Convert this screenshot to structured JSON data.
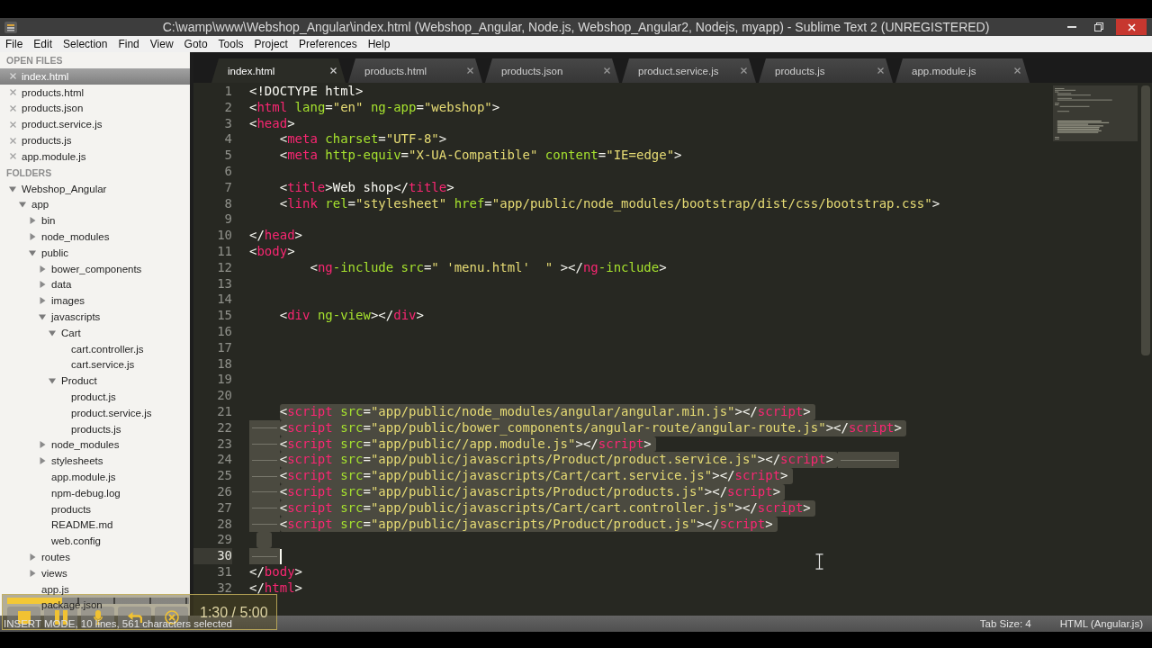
{
  "window": {
    "title": "C:\\wamp\\www\\Webshop_Angular\\index.html (Webshop_Angular, Node.js, Webshop_Angular2, Nodejs, myapp) - Sublime Text 2 (UNREGISTERED)"
  },
  "menu": [
    "File",
    "Edit",
    "Selection",
    "Find",
    "View",
    "Goto",
    "Tools",
    "Project",
    "Preferences",
    "Help"
  ],
  "sidebar": {
    "open_files_heading": "OPEN FILES",
    "open_files": [
      {
        "name": "index.html",
        "selected": true
      },
      {
        "name": "products.html",
        "selected": false
      },
      {
        "name": "products.json",
        "selected": false
      },
      {
        "name": "product.service.js",
        "selected": false
      },
      {
        "name": "products.js",
        "selected": false
      },
      {
        "name": "app.module.js",
        "selected": false
      }
    ],
    "folders_heading": "FOLDERS",
    "folders": [
      {
        "name": "Webshop_Angular",
        "kind": "folder",
        "expanded": true,
        "children": [
          {
            "name": "app",
            "kind": "folder",
            "expanded": true,
            "children": [
              {
                "name": "bin",
                "kind": "folder",
                "expanded": false
              },
              {
                "name": "node_modules",
                "kind": "folder",
                "expanded": false
              },
              {
                "name": "public",
                "kind": "folder",
                "expanded": true,
                "children": [
                  {
                    "name": "bower_components",
                    "kind": "folder",
                    "expanded": false
                  },
                  {
                    "name": "data",
                    "kind": "folder",
                    "expanded": false
                  },
                  {
                    "name": "images",
                    "kind": "folder",
                    "expanded": false
                  },
                  {
                    "name": "javascripts",
                    "kind": "folder",
                    "expanded": true,
                    "children": [
                      {
                        "name": "Cart",
                        "kind": "folder",
                        "expanded": true,
                        "children": [
                          {
                            "name": "cart.controller.js",
                            "kind": "file"
                          },
                          {
                            "name": "cart.service.js",
                            "kind": "file"
                          }
                        ]
                      },
                      {
                        "name": "Product",
                        "kind": "folder",
                        "expanded": true,
                        "children": [
                          {
                            "name": "product.js",
                            "kind": "file"
                          },
                          {
                            "name": "product.service.js",
                            "kind": "file"
                          },
                          {
                            "name": "products.js",
                            "kind": "file"
                          }
                        ]
                      }
                    ]
                  },
                  {
                    "name": "node_modules",
                    "kind": "folder",
                    "expanded": false
                  },
                  {
                    "name": "stylesheets",
                    "kind": "folder",
                    "expanded": false
                  },
                  {
                    "name": "app.module.js",
                    "kind": "file"
                  },
                  {
                    "name": "npm-debug.log",
                    "kind": "file"
                  },
                  {
                    "name": "products",
                    "kind": "file"
                  },
                  {
                    "name": "README.md",
                    "kind": "file"
                  },
                  {
                    "name": "web.config",
                    "kind": "file"
                  }
                ]
              },
              {
                "name": "routes",
                "kind": "folder",
                "expanded": false
              },
              {
                "name": "views",
                "kind": "folder",
                "expanded": false
              },
              {
                "name": "app.js",
                "kind": "file"
              },
              {
                "name": "package.json",
                "kind": "file"
              }
            ]
          }
        ]
      }
    ]
  },
  "tabs": [
    {
      "label": "index.html",
      "selected": true
    },
    {
      "label": "products.html",
      "selected": false
    },
    {
      "label": "products.json",
      "selected": false
    },
    {
      "label": "product.service.js",
      "selected": false
    },
    {
      "label": "products.js",
      "selected": false
    },
    {
      "label": "app.module.js",
      "selected": false
    }
  ],
  "editor": {
    "lines": [
      {
        "number": "1",
        "code": "<!DOCTYPE html>",
        "kind": "plain",
        "selected": false,
        "cursor": false
      },
      {
        "number": "2",
        "code": "<html lang=\"en\" ng-app=\"webshop\">",
        "kind": "plain",
        "selected": false,
        "cursor": false
      },
      {
        "number": "3",
        "code": "<head>",
        "kind": "plain",
        "selected": false,
        "cursor": false
      },
      {
        "number": "4",
        "code": "    <meta charset=\"UTF-8\">",
        "kind": "plain",
        "selected": false,
        "cursor": false
      },
      {
        "number": "5",
        "code": "    <meta http-equiv=\"X-UA-Compatible\" content=\"IE=edge\">",
        "kind": "plain",
        "selected": false,
        "cursor": false
      },
      {
        "number": "6",
        "kind": "plain",
        "selected": false,
        "cursor": false
      },
      {
        "number": "7",
        "code": "    <title>Web shop</title>",
        "kind": "plain",
        "selected": false,
        "cursor": false
      },
      {
        "number": "8",
        "code": "    <link rel=\"stylesheet\" href=\"app/public/node_modules/bootstrap/dist/css/bootstrap.css\">",
        "kind": "plain",
        "selected": false,
        "cursor": false
      },
      {
        "number": "9",
        "kind": "plain",
        "selected": false,
        "cursor": false
      },
      {
        "number": "10",
        "code": "</head>",
        "kind": "plain",
        "selected": false,
        "cursor": false
      },
      {
        "number": "11",
        "code": "<body>",
        "kind": "plain",
        "selected": false,
        "cursor": false
      },
      {
        "number": "12",
        "code": "        <ng-include src=\" 'menu.html'  \" ></ng-include>",
        "kind": "plain",
        "selected": false,
        "cursor": false
      },
      {
        "number": "13",
        "kind": "plain",
        "selected": false,
        "cursor": false
      },
      {
        "number": "14",
        "kind": "plain",
        "selected": false,
        "cursor": false
      },
      {
        "number": "15",
        "code": "    <div ng-view></div>",
        "kind": "plain",
        "selected": false,
        "cursor": false
      },
      {
        "number": "16",
        "kind": "plain",
        "selected": false,
        "cursor": false
      },
      {
        "number": "17",
        "kind": "plain",
        "selected": false,
        "cursor": false
      },
      {
        "number": "18",
        "kind": "plain",
        "selected": false,
        "cursor": false
      },
      {
        "number": "19",
        "kind": "plain",
        "selected": false,
        "cursor": false
      },
      {
        "number": "20",
        "kind": "plain",
        "selected": false,
        "cursor": false
      },
      {
        "number": "21",
        "code": "    <script src=\"app/public/node_modules/angular/angular.min.js\"></script>",
        "kind": "plain",
        "selected": true,
        "cursor": false
      },
      {
        "number": "22",
        "code": "<script src=\"app/public/bower_components/angular-route/angular-route.js\"></script>",
        "kind": "tab_indent",
        "selected": true,
        "cursor": false
      },
      {
        "number": "23",
        "code": "<script src=\"app/public//app.module.js\"></script>",
        "kind": "tab_indent",
        "selected": true,
        "cursor": false
      },
      {
        "number": "24",
        "code": "<script src=\"app/public/javascripts/Product/product.service.js\"></script>",
        "kind": "tab_indent_trailing",
        "selected": true,
        "cursor": false
      },
      {
        "number": "25",
        "code": "<script src=\"app/public/javascripts/Cart/cart.service.js\"></script>",
        "kind": "tab_indent",
        "selected": true,
        "cursor": false
      },
      {
        "number": "26",
        "code": "<script src=\"app/public/javascripts/Product/products.js\"></script>",
        "kind": "tab_indent",
        "selected": true,
        "cursor": false
      },
      {
        "number": "27",
        "code": "<script src=\"app/public/javascripts/Cart/cart.controller.js\"></script>",
        "kind": "tab_indent",
        "selected": true,
        "cursor": false
      },
      {
        "number": "28",
        "code": "<script src=\"app/public/javascripts/Product/product.js\"></script>",
        "kind": "tab_indent",
        "selected": true,
        "cursor": false
      },
      {
        "number": "29",
        "kind": "plain",
        "selected": true,
        "cursor": false
      },
      {
        "number": "30",
        "kind": "tab_indent",
        "selected": true,
        "cursor": true
      },
      {
        "number": "31",
        "code": "</body>",
        "kind": "plain",
        "selected": false,
        "cursor": false
      },
      {
        "number": "32",
        "code": "</html>",
        "kind": "plain",
        "selected": false,
        "cursor": false
      }
    ]
  },
  "status_bar": {
    "message": "INSERT MODE, 10 lines, 561 characters selected",
    "tab_size": "Tab Size: 4",
    "syntax": "HTML (Angular.js)"
  },
  "player": {
    "level": 0.3,
    "time": "1:30 / 5:00"
  }
}
